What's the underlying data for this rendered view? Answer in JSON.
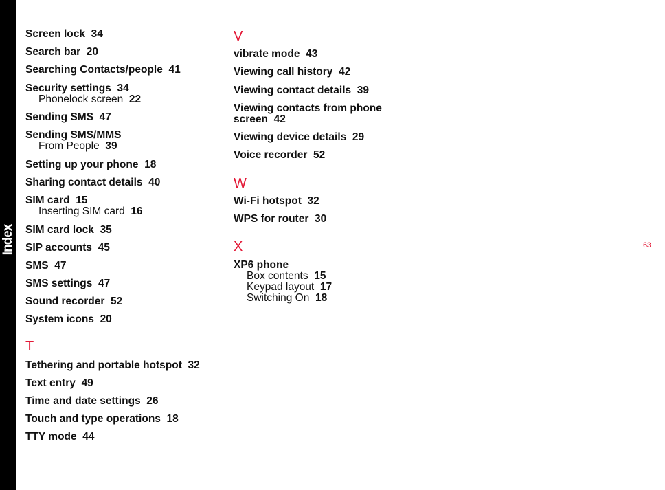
{
  "sidebar": {
    "label": "Index"
  },
  "page_number": "63",
  "colors": {
    "accent": "#e31937",
    "sidebar": "#000000",
    "text": "#111111"
  },
  "left_column": {
    "entries": [
      {
        "term": "Screen lock",
        "page": "34"
      },
      {
        "term": "Search bar",
        "page": "20"
      },
      {
        "term": "Searching Contacts/people",
        "page": "41"
      },
      {
        "term": "Security settings",
        "page": "34",
        "subs": [
          {
            "term": "Phonelock screen",
            "page": "22"
          }
        ]
      },
      {
        "term": "Sending SMS",
        "page": "47"
      },
      {
        "term": "Sending SMS/MMS",
        "page": "",
        "subs": [
          {
            "term": "From People",
            "page": "39"
          }
        ]
      },
      {
        "term": "Setting up your phone",
        "page": "18"
      },
      {
        "term": "Sharing contact details",
        "page": "40"
      },
      {
        "term": "SIM card",
        "page": "15",
        "subs": [
          {
            "term": "Inserting SIM card",
            "page": "16"
          }
        ]
      },
      {
        "term": "SIM card lock",
        "page": "35"
      },
      {
        "term": "SIP accounts",
        "page": "45"
      },
      {
        "term": "SMS",
        "page": "47"
      },
      {
        "term": "SMS settings",
        "page": "47"
      },
      {
        "term": "Sound recorder",
        "page": "52"
      },
      {
        "term": "System icons",
        "page": "20"
      }
    ],
    "section_t": {
      "letter": "T",
      "entries": [
        {
          "term": "Tethering and portable hotspot",
          "page": "32"
        },
        {
          "term": "Text entry",
          "page": "49"
        },
        {
          "term": "Time and date settings",
          "page": "26"
        },
        {
          "term": "Touch and type operations",
          "page": "18"
        },
        {
          "term": "TTY mode",
          "page": "44"
        }
      ]
    }
  },
  "right_column": {
    "section_v": {
      "letter": "V",
      "entries": [
        {
          "term": "vibrate mode",
          "page": "43"
        },
        {
          "term": "Viewing call history",
          "page": "42"
        },
        {
          "term": "Viewing contact details",
          "page": "39"
        },
        {
          "term": "Viewing contacts from phone",
          "term2": "screen",
          "page": "42"
        },
        {
          "term": "Viewing device details",
          "page": "29"
        },
        {
          "term": "Voice recorder",
          "page": "52"
        }
      ]
    },
    "section_w": {
      "letter": "W",
      "entries": [
        {
          "term": "Wi-Fi hotspot",
          "page": "32"
        },
        {
          "term": "WPS for router",
          "page": "30"
        }
      ]
    },
    "section_x": {
      "letter": "X",
      "entries": [
        {
          "term": "XP6 phone",
          "page": "",
          "subs": [
            {
              "term": "Box contents",
              "page": "15"
            },
            {
              "term": "Keypad layout",
              "page": "17"
            },
            {
              "term": "Switching On",
              "page": "18"
            }
          ]
        }
      ]
    }
  }
}
